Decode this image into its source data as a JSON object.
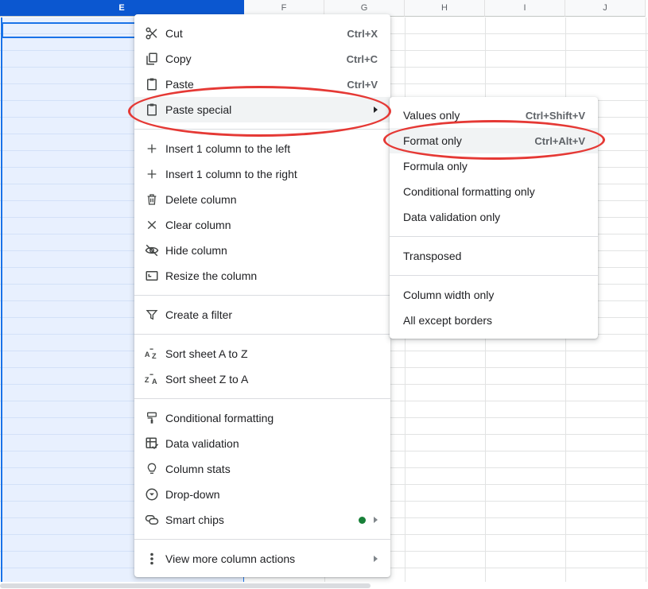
{
  "sheet": {
    "columns": [
      "E",
      "F",
      "G",
      "H",
      "I",
      "J"
    ],
    "selected_column": "E"
  },
  "context_menu": {
    "items": [
      {
        "icon": "scissors-icon",
        "label": "Cut",
        "shortcut": "Ctrl+X"
      },
      {
        "icon": "copy-icon",
        "label": "Copy",
        "shortcut": "Ctrl+C"
      },
      {
        "icon": "clipboard-icon",
        "label": "Paste",
        "shortcut": "Ctrl+V"
      },
      {
        "icon": "clipboard-icon",
        "label": "Paste special",
        "submenu": true,
        "highlighted": true
      },
      {
        "icon": "plus-icon",
        "label": "Insert 1 column to the left"
      },
      {
        "icon": "plus-icon",
        "label": "Insert 1 column to the right"
      },
      {
        "icon": "trash-icon",
        "label": "Delete column"
      },
      {
        "icon": "x-icon",
        "label": "Clear column"
      },
      {
        "icon": "eye-off-icon",
        "label": "Hide column"
      },
      {
        "icon": "resize-icon",
        "label": "Resize the column"
      },
      {
        "icon": "filter-icon",
        "label": "Create a filter"
      },
      {
        "icon": "sort-az-icon",
        "label": "Sort sheet A to Z"
      },
      {
        "icon": "sort-za-icon",
        "label": "Sort sheet Z to A"
      },
      {
        "icon": "paint-roller-icon",
        "label": "Conditional formatting"
      },
      {
        "icon": "data-validation-icon",
        "label": "Data validation"
      },
      {
        "icon": "lightbulb-icon",
        "label": "Column stats"
      },
      {
        "icon": "dropdown-icon",
        "label": "Drop-down"
      },
      {
        "icon": "smart-chips-icon",
        "label": "Smart chips",
        "submenu": true,
        "status_color": "#188038"
      },
      {
        "icon": "more-vert-icon",
        "label": "View more column actions",
        "submenu": true
      }
    ]
  },
  "paste_special_menu": {
    "items": [
      {
        "label": "Values only",
        "shortcut": "Ctrl+Shift+V"
      },
      {
        "label": "Format only",
        "shortcut": "Ctrl+Alt+V",
        "highlighted": true
      },
      {
        "label": "Formula only"
      },
      {
        "label": "Conditional formatting only"
      },
      {
        "label": "Data validation only"
      },
      {
        "label": "Transposed"
      },
      {
        "label": "Column width only"
      },
      {
        "label": "All except borders"
      }
    ]
  },
  "colors": {
    "selection": "#1a73e8",
    "annotation": "#e53935"
  }
}
